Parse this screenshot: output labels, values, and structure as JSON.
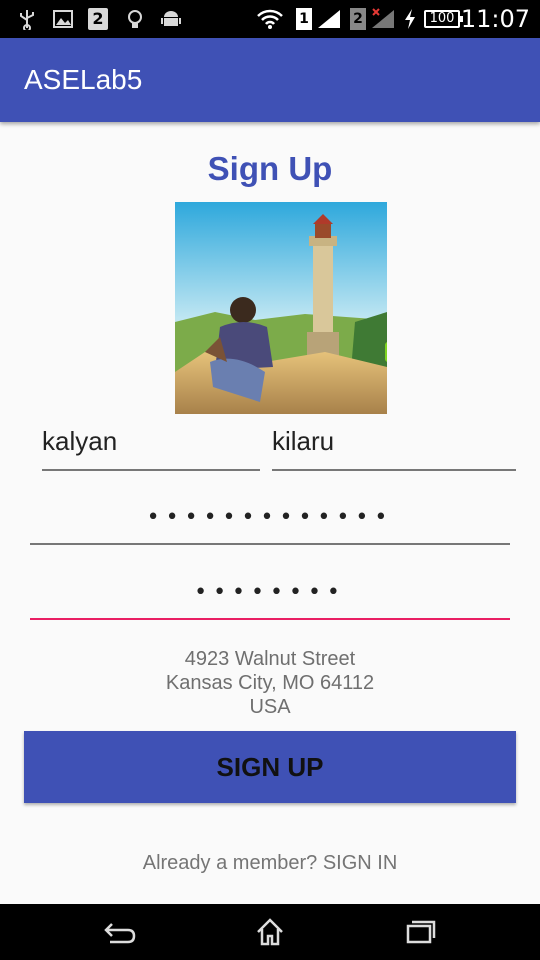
{
  "status_bar": {
    "time": "11:07",
    "battery": "100",
    "sim1": "1",
    "sim2": "2",
    "notif_count": "2",
    "icons": [
      "usb-icon",
      "image-icon",
      "notification-2-icon",
      "lightbulb-icon",
      "android-icon",
      "wifi-icon",
      "signal-sim1-icon",
      "signal-sim2-icon",
      "charging-icon",
      "battery-icon"
    ]
  },
  "app_bar": {
    "title": "ASELab5"
  },
  "form": {
    "heading": "Sign Up",
    "first_name": "kalyan",
    "last_name": "kilaru",
    "password": "•••••••••••••",
    "confirm_password": "••••••••",
    "address_line1": "4923 Walnut Street",
    "address_line2": "Kansas City, MO 64112",
    "address_line3": "USA",
    "signup_button": "SIGN UP",
    "signin_link": "Already a member? SIGN IN"
  },
  "colors": {
    "primary": "#3f51b5",
    "accent": "#e91e63",
    "background": "#fafafa"
  },
  "nav_bar": {
    "icons": [
      "back-icon",
      "home-icon",
      "recents-icon"
    ]
  }
}
